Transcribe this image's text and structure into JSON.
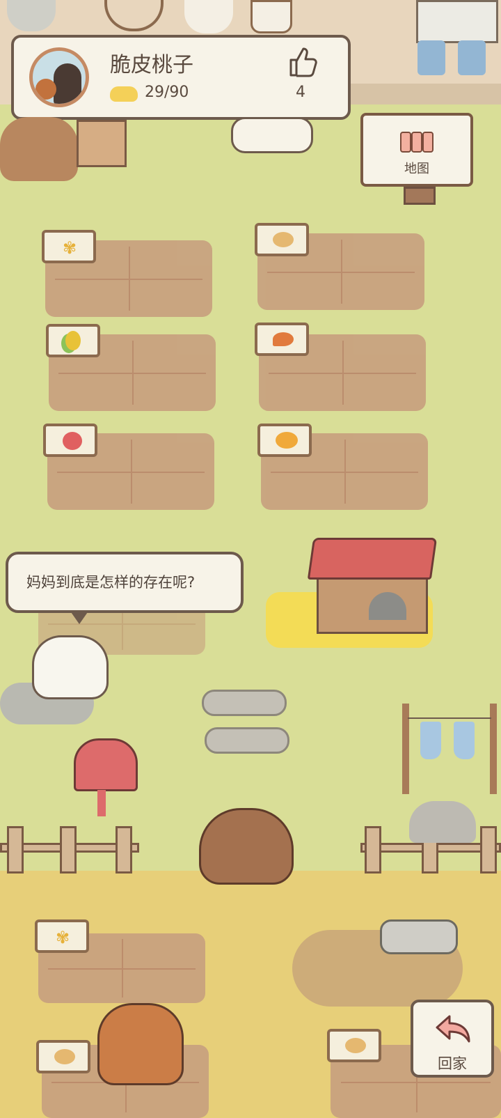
{
  "player": {
    "name": "脆皮桃子",
    "energy": "29/90",
    "likes": "4"
  },
  "buttons": {
    "map_label": "地图",
    "home_label": "回家"
  },
  "dialogue": {
    "text": "妈妈到底是怎样的存在呢?"
  },
  "crops": [
    {
      "slot": "plot-1",
      "crop": "wheat-icon"
    },
    {
      "slot": "plot-2",
      "crop": "potato-icon"
    },
    {
      "slot": "plot-3",
      "crop": "corn-icon"
    },
    {
      "slot": "plot-4",
      "crop": "carrot-icon"
    },
    {
      "slot": "plot-5",
      "crop": "tomato-icon"
    },
    {
      "slot": "plot-6",
      "crop": "mango-icon"
    },
    {
      "slot": "plot-7",
      "crop": "wheat-icon"
    },
    {
      "slot": "plot-8",
      "crop": "potato-icon"
    },
    {
      "slot": "plot-9",
      "crop": "potato-icon"
    }
  ],
  "colors": {
    "grass": "#d9de97",
    "soil": "#c8a17f",
    "panel": "#f7f3e8",
    "outline": "#6d5a4c",
    "roof": "#d86460",
    "mailbox": "#dd6b6b"
  }
}
